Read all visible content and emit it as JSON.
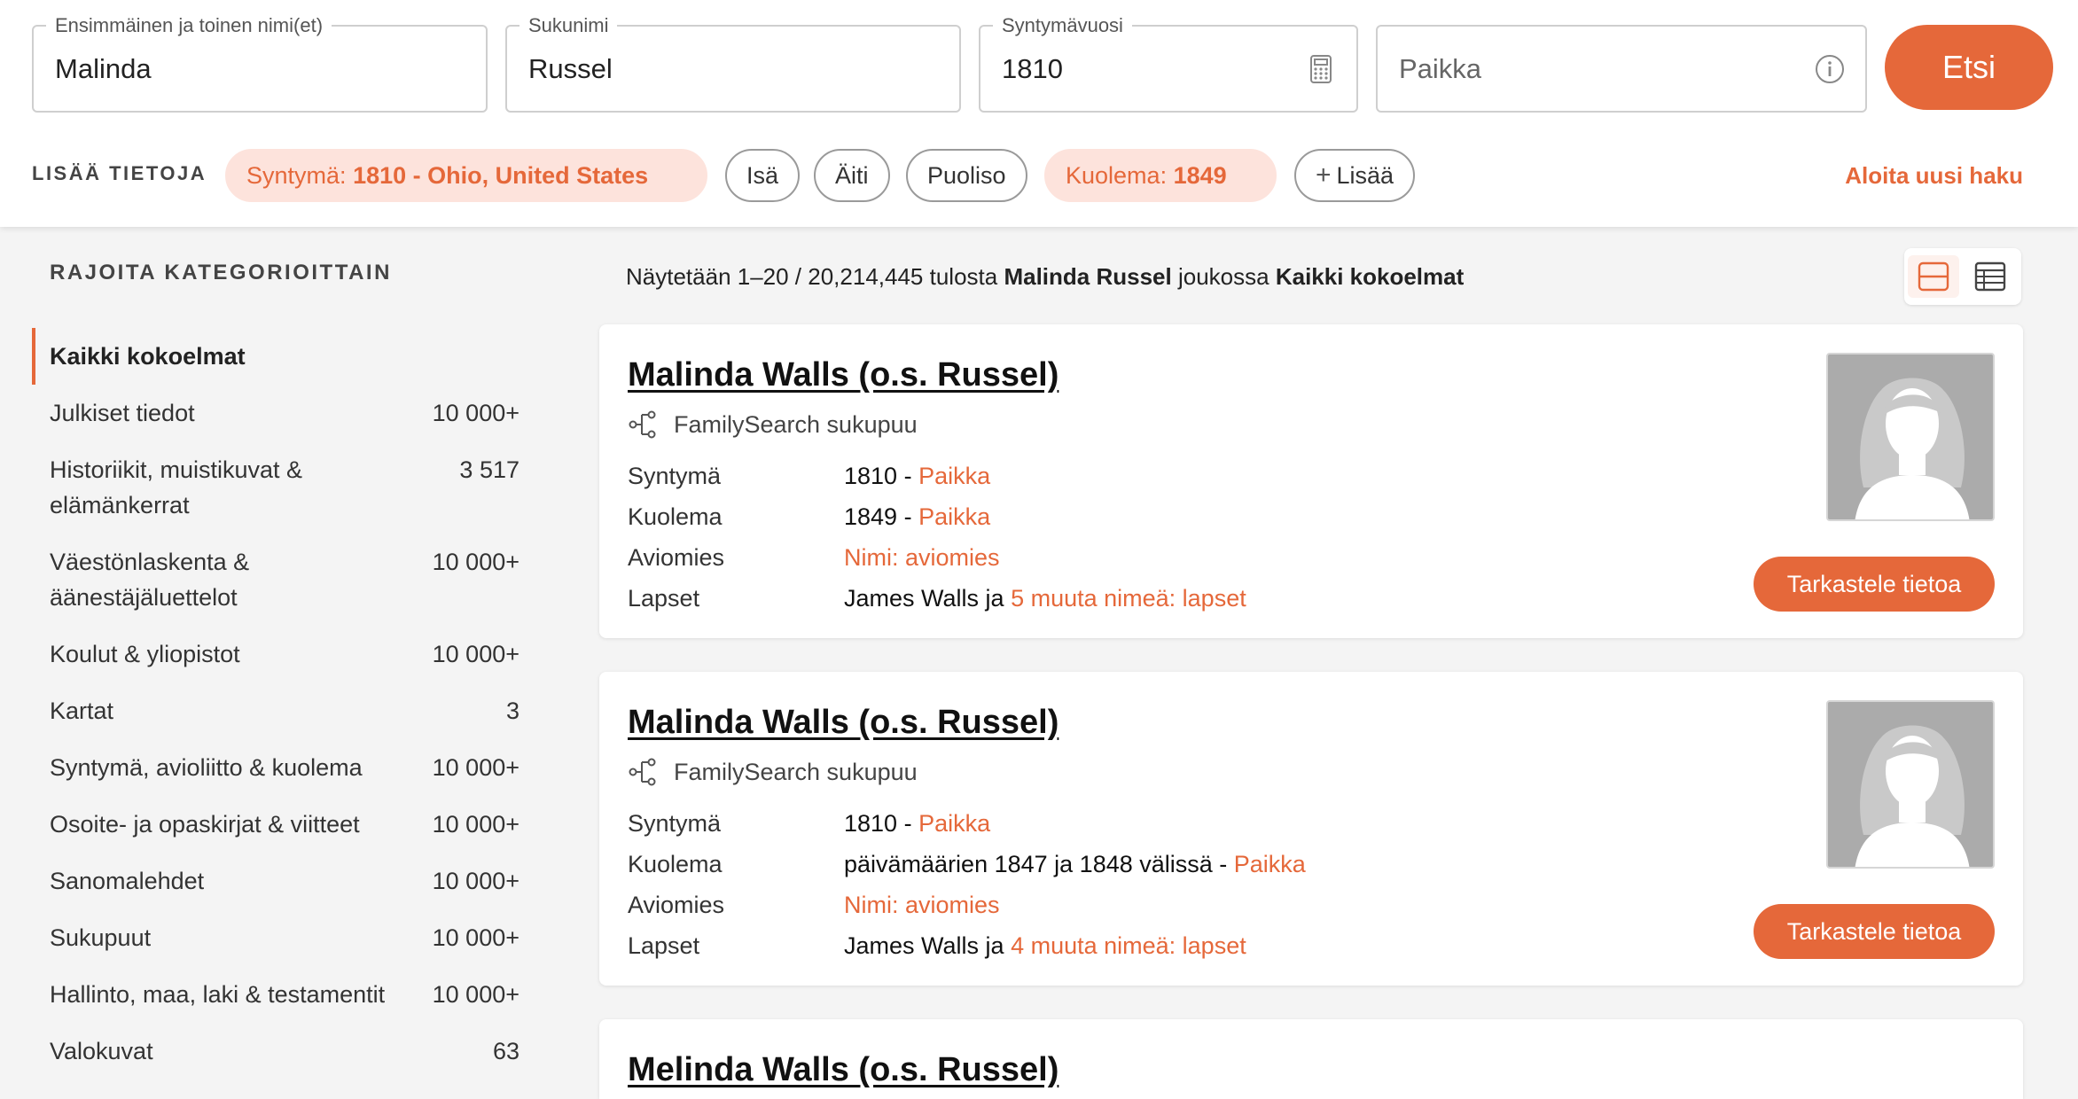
{
  "search": {
    "first_name_label": "Ensimmäinen ja toinen nimi(et)",
    "first_name_value": "Malinda",
    "surname_label": "Sukunimi",
    "surname_value": "Russel",
    "birth_year_label": "Syntymävuosi",
    "birth_year_value": "1810",
    "place_placeholder": "Paikka",
    "search_button": "Etsi"
  },
  "more_info": {
    "label": "LISÄÄ TIETOJA",
    "chips": {
      "birth_prefix": "Syntymä:",
      "birth_value": "1810 - Ohio, United States",
      "father": "Isä",
      "mother": "Äiti",
      "spouse": "Puoliso",
      "death_prefix": "Kuolema:",
      "death_value": "1849",
      "add": "Lisää"
    },
    "new_search": "Aloita uusi haku"
  },
  "sidebar": {
    "title": "RAJOITA KATEGORIOITTAIN",
    "items": [
      {
        "label": "Kaikki kokoelmat",
        "count": ""
      },
      {
        "label": "Julkiset tiedot",
        "count": "10 000+"
      },
      {
        "label": "Historiikit, muistikuvat & elämänkerrat",
        "count": "3 517"
      },
      {
        "label": "Väestönlaskenta & äänestäjäluettelot",
        "count": "10 000+"
      },
      {
        "label": "Koulut & yliopistot",
        "count": "10 000+"
      },
      {
        "label": "Kartat",
        "count": "3"
      },
      {
        "label": "Syntymä, avioliitto & kuolema",
        "count": "10 000+"
      },
      {
        "label": "Osoite- ja opaskirjat & viitteet",
        "count": "10 000+"
      },
      {
        "label": "Sanomalehdet",
        "count": "10 000+"
      },
      {
        "label": "Sukupuut",
        "count": "10 000+"
      },
      {
        "label": "Hallinto, maa, laki & testamentit",
        "count": "10 000+"
      },
      {
        "label": "Valokuvat",
        "count": "63"
      }
    ]
  },
  "summary": {
    "prefix": "Näytetään 1–20 / 20,214,445 tulosta",
    "name": "Malinda Russel",
    "middle": "joukossa",
    "collection": "Kaikki kokoelmat"
  },
  "results": [
    {
      "name": "Malinda Walls (o.s. Russel)",
      "source": "FamilySearch sukupuu",
      "birth_label": "Syntymä",
      "birth_value": "1810 -",
      "birth_link": "Paikka",
      "death_label": "Kuolema",
      "death_value": "1849 -",
      "death_link": "Paikka",
      "spouse_label": "Aviomies",
      "spouse_link": "Nimi: aviomies",
      "children_label": "Lapset",
      "children_value": "James Walls ja",
      "children_link": "5 muuta nimeä: lapset",
      "button": "Tarkastele tietoa"
    },
    {
      "name": "Malinda Walls (o.s. Russel)",
      "source": "FamilySearch sukupuu",
      "birth_label": "Syntymä",
      "birth_value": "1810 -",
      "birth_link": "Paikka",
      "death_label": "Kuolema",
      "death_value": "päivämäärien 1847 ja 1848 välissä -",
      "death_link": "Paikka",
      "spouse_label": "Aviomies",
      "spouse_link": "Nimi: aviomies",
      "children_label": "Lapset",
      "children_value": "James Walls ja",
      "children_link": "4 muuta nimeä: lapset",
      "button": "Tarkastele tietoa"
    },
    {
      "name": "Melinda Walls (o.s. Russel)"
    }
  ],
  "colors": {
    "accent": "#e5683a",
    "chip_fill": "#fde3dc"
  }
}
